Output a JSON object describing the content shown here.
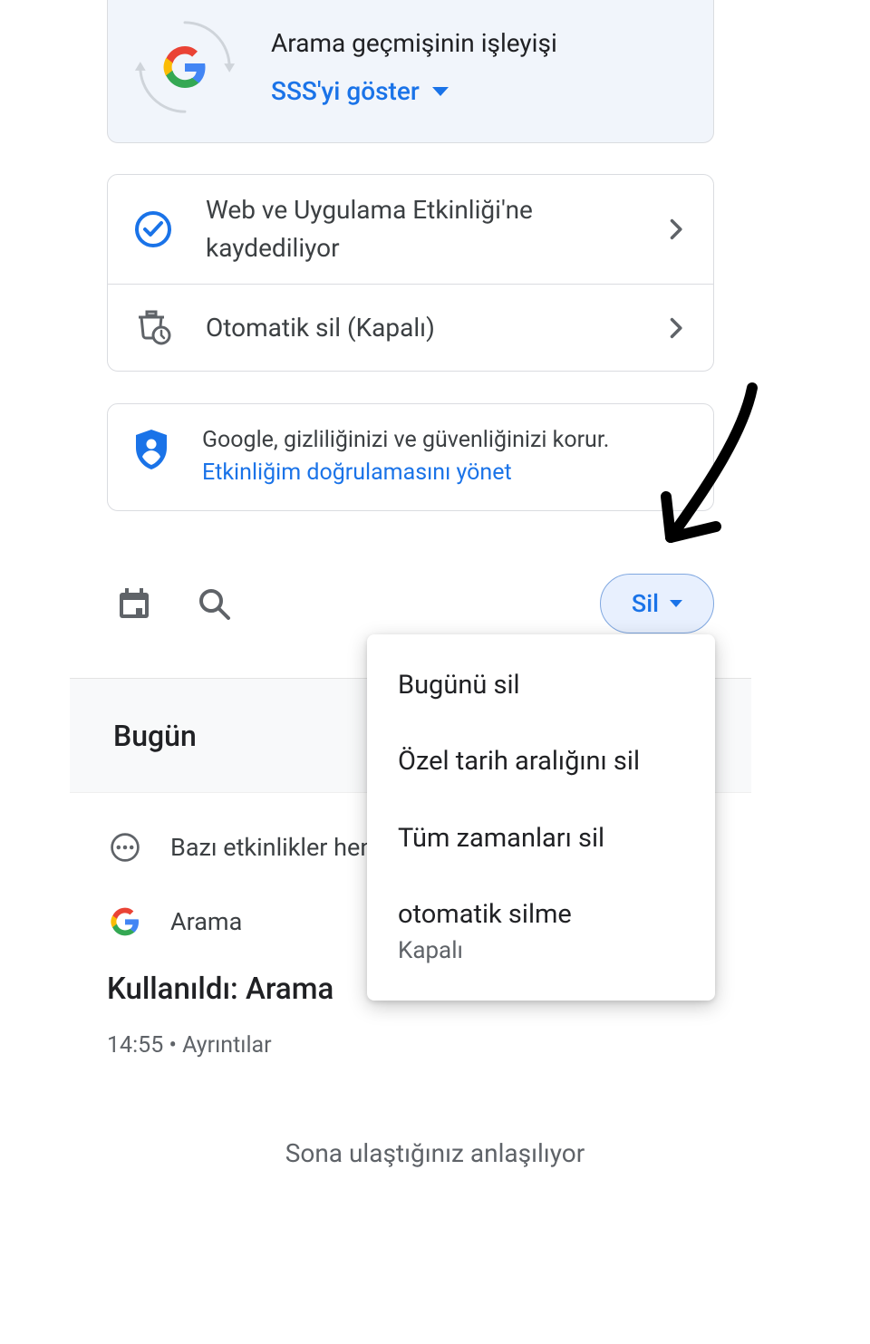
{
  "info_card": {
    "title": "Arama geçmişinin işleyişi",
    "faq_link": "SSS'yi göster"
  },
  "settings": {
    "row1": "Web ve Uygulama Etkinliği'ne kaydediliyor",
    "row2": "Otomatik sil (Kapalı)"
  },
  "privacy": {
    "line1": "Google, gizliliğinizi ve güvenliğinizi korur.",
    "link": "Etkinliğim doğrulamasını yönet"
  },
  "toolbar": {
    "delete_label": "Sil"
  },
  "section": {
    "today": "Bugün"
  },
  "list": {
    "pending_text": "Bazı etkinlikler hen",
    "search_label": "Arama",
    "used_label": "Kullanıldı: Arama",
    "time": "14:55",
    "dot": " • ",
    "details": "Ayrıntılar"
  },
  "menu": {
    "item1": "Bugünü sil",
    "item2": "Özel tarih aralığını sil",
    "item3": "Tüm zamanları sil",
    "item4": "otomatik silme",
    "item4_sub": "Kapalı"
  },
  "footer": {
    "end": "Sona ulaştığınız anlaşılıyor"
  }
}
